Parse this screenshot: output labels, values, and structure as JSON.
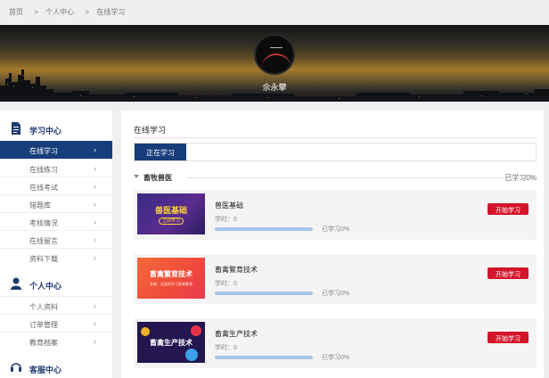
{
  "breadcrumb": [
    "首页",
    "个人中心",
    "在线学习"
  ],
  "breadcrumb_sep": ">",
  "profile": {
    "username": "佘永攀"
  },
  "sidebar": {
    "sections": [
      {
        "title": "学习中心",
        "icon": "document-icon",
        "items": [
          "在线学习",
          "在线练习",
          "在线考试",
          "错题库",
          "考核情况",
          "在线留言",
          "资料下载"
        ]
      },
      {
        "title": "个人中心",
        "icon": "user-icon",
        "items": [
          "个人资料",
          "订单管理",
          "教育档案"
        ]
      },
      {
        "title": "客服中心",
        "icon": "headset-icon",
        "items": []
      }
    ],
    "active_item": "在线学习"
  },
  "main": {
    "title": "在线学习",
    "active_tab": "正在学习",
    "category": {
      "name": "畜牧兽医",
      "progress_text": "已学习0%"
    },
    "courses": [
      {
        "name": "兽医基础",
        "hours_text": "学时：0",
        "progress": 0,
        "progress_text": "已学习0%",
        "button": "开始学习",
        "thumb_title": "兽医基础",
        "thumb_sub": "立即学习",
        "thumb_bg": "#4a2a8a"
      },
      {
        "name": "畜禽繁育技术",
        "hours_text": "学时：0",
        "progress": 0,
        "progress_text": "已学习0%",
        "button": "开始学习",
        "thumb_title": "畜禽繁育技术",
        "thumb_sub": "系统、全面的学习畜禽繁育",
        "thumb_bg": "#f05a3c"
      },
      {
        "name": "畜禽生产技术",
        "hours_text": "学时：0",
        "progress": 0,
        "progress_text": "已学习0%",
        "button": "开始学习",
        "thumb_title": "畜禽生产技术",
        "thumb_sub": "",
        "thumb_bg": "#2a1a5e"
      }
    ]
  },
  "colors": {
    "primary": "#173d7a",
    "accent_red": "#d4152a",
    "progress_track": "#a9c6e8"
  }
}
